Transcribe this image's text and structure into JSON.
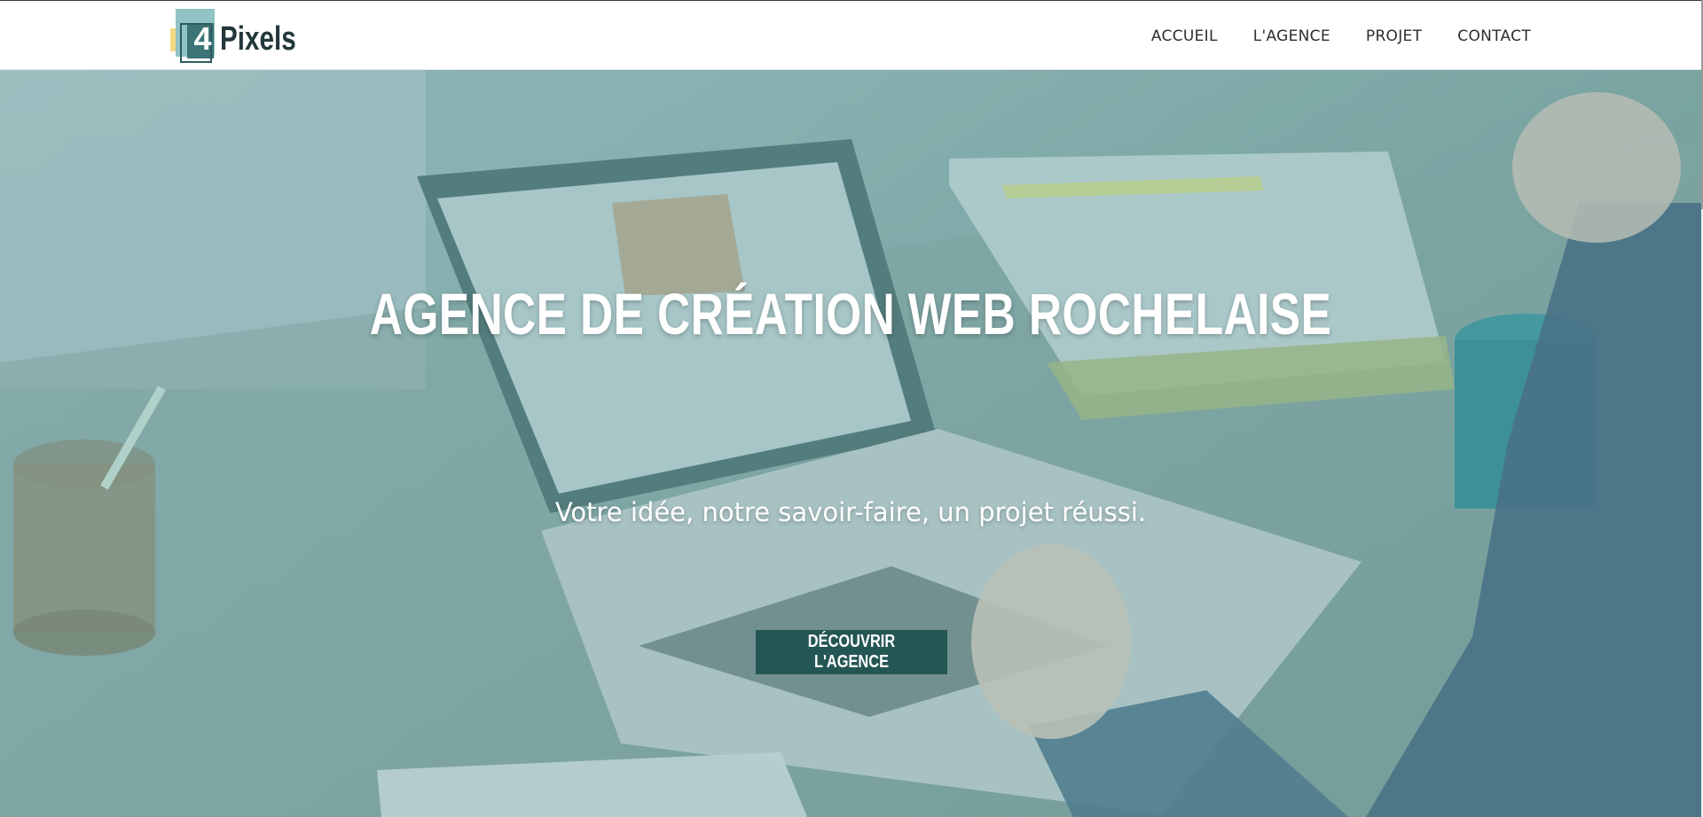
{
  "brand": {
    "logo_digit": "4",
    "logo_word": "Pixels",
    "colors": {
      "accent": "#245654",
      "logo_teal": "#3b7376",
      "logo_light": "#8fc3c4",
      "logo_yellow": "#f1d883"
    }
  },
  "nav": {
    "items": [
      {
        "label": "ACCUEIL"
      },
      {
        "label": "L'AGENCE"
      },
      {
        "label": "PROJET"
      },
      {
        "label": "CONTACT"
      }
    ]
  },
  "hero": {
    "title": "AGENCE DE CRÉATION WEB ROCHELAISE",
    "subtitle": "Votre idée, notre savoir-faire, un projet réussi.",
    "cta_label": "DÉCOUVRIR L'AGENCE",
    "overlay_color": "#387a7a"
  }
}
